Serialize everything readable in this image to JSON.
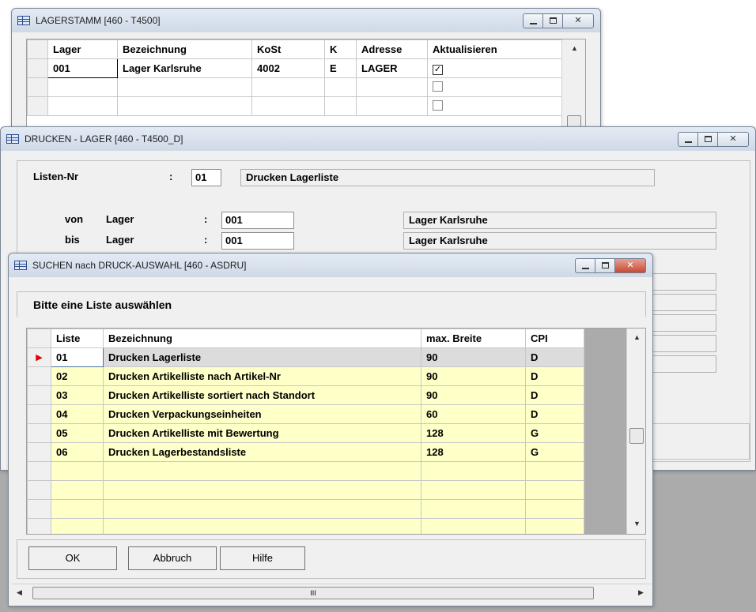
{
  "window1": {
    "title": "LAGERSTAMM  [460 - T4500]",
    "columns": [
      "Lager",
      "Bezeichnung",
      "KoSt",
      "K",
      "Adresse",
      "Aktualisieren"
    ],
    "rows": [
      {
        "lager": "001",
        "bezeichnung": "Lager Karlsruhe",
        "kost": "4002",
        "k": "E",
        "adresse": "LAGER",
        "aktualisieren": true
      }
    ]
  },
  "window2": {
    "title": "DRUCKEN - LAGER  [460 - T4500_D]",
    "listen_nr_label": "Listen-Nr",
    "colon": ":",
    "listen_nr_value": "01",
    "listen_name": "Drucken Lagerliste",
    "von_label": "von",
    "bis_label": "bis",
    "lager_label": "Lager",
    "von_value": "001",
    "bis_value": "001",
    "von_name": "Lager Karlsruhe",
    "bis_name": "Lager Karlsruhe"
  },
  "window3": {
    "title": "SUCHEN nach DRUCK-AUSWAHL  [460 - ASDRU]",
    "prompt": "Bitte eine Liste auswählen",
    "columns": [
      "Liste",
      "Bezeichnung",
      "max. Breite",
      "CPI"
    ],
    "rows": [
      {
        "liste": "01",
        "bezeichnung": "Drucken Lagerliste",
        "breite": "90",
        "cpi": "D"
      },
      {
        "liste": "02",
        "bezeichnung": "Drucken Artikelliste nach Artikel-Nr",
        "breite": "90",
        "cpi": "D"
      },
      {
        "liste": "03",
        "bezeichnung": "Drucken Artikelliste sortiert nach Standort",
        "breite": "90",
        "cpi": "D"
      },
      {
        "liste": "04",
        "bezeichnung": "Drucken Verpackungseinheiten",
        "breite": "60",
        "cpi": "D"
      },
      {
        "liste": "05",
        "bezeichnung": "Drucken Artikelliste mit Bewertung",
        "breite": "128",
        "cpi": "G"
      },
      {
        "liste": "06",
        "bezeichnung": "Drucken Lagerbestandsliste",
        "breite": "128",
        "cpi": "G"
      }
    ],
    "buttons": {
      "ok": "OK",
      "cancel": "Abbruch",
      "help": "Hilfe"
    },
    "hscroll_grip": "III"
  },
  "colors": {
    "row_highlight": "#ffffc8",
    "selected_row": "#dcdcdc",
    "row_marker": "#e00000",
    "close_button": "#c74a33"
  }
}
